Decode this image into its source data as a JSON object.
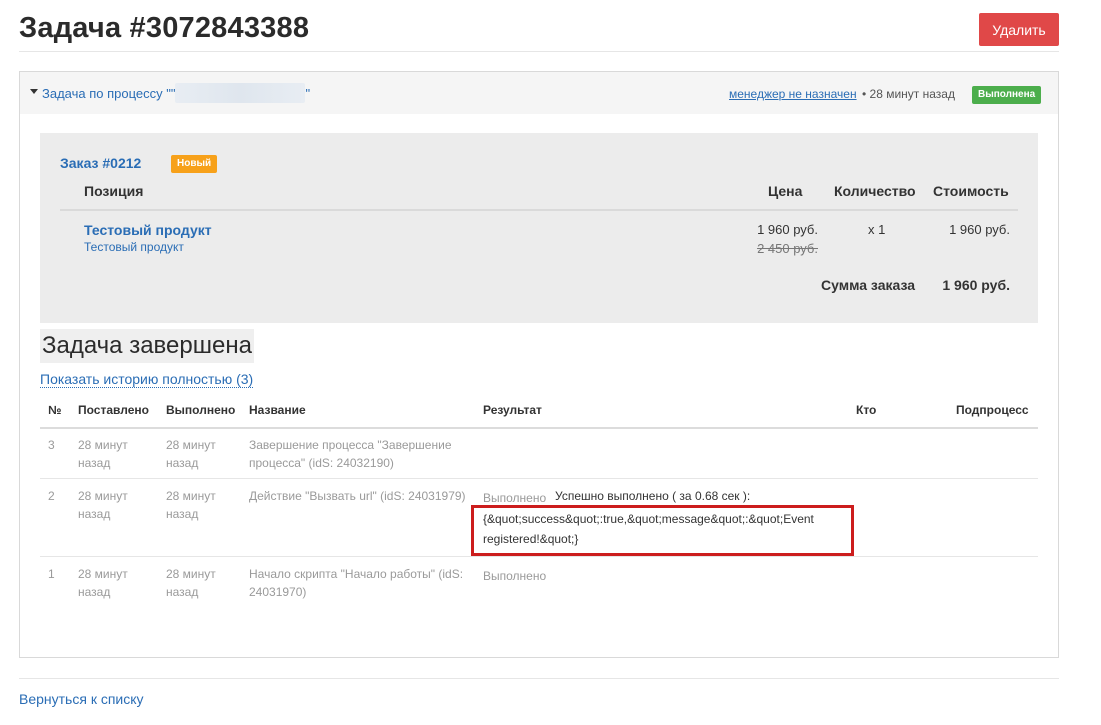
{
  "page": {
    "title": "Задача #3072843388",
    "delete_label": "Удалить"
  },
  "task_header": {
    "process_prefix": "Задача по процессу \"\"",
    "process_suffix": "\"",
    "manager_link": "менеджер не назначен",
    "time": "• 28 минут назад",
    "status": "Выполнена"
  },
  "order": {
    "link": "Заказ #0212",
    "badge": "Новый",
    "headers": {
      "position": "Позиция",
      "price": "Цена",
      "qty": "Количество",
      "cost": "Стоимость"
    },
    "item": {
      "name": "Тестовый продукт",
      "sub": "Тестовый продукт",
      "price": "1 960 руб.",
      "old_price": "2 450 руб.",
      "qty": "x 1",
      "cost": "1 960 руб."
    },
    "sum_label": "Сумма заказа",
    "sum_value": "1 960 руб."
  },
  "done_heading": "Задача завершена",
  "history_link": "Показать историю полностью (3)",
  "history": {
    "headers": [
      "№",
      "Поставлено",
      "Выполнено",
      "Название",
      "Результат",
      "Кто",
      "Подпроцесс"
    ],
    "rows": [
      {
        "n": "3",
        "placed": "28 минут назад",
        "done": "28 минут назад",
        "name": "Завершение процесса \"Завершение процесса\" (idS: 24032190)",
        "result_status": "",
        "result_detail": ""
      },
      {
        "n": "2",
        "placed": "28 минут назад",
        "done": "28 минут назад",
        "name": "Действие \"Вызвать url\" (idS: 24031979)",
        "result_status": "Выполнено",
        "result_detail": "Успешно выполнено ( за 0.68 сек ):",
        "result_body": "{&quot;success&quot;:true,&quot;message&quot;:&quot;Event registered!&quot;}"
      },
      {
        "n": "1",
        "placed": "28 минут назад",
        "done": "28 минут назад",
        "name": "Начало скрипта \"Начало работы\" (idS: 24031970)",
        "result_status": "Выполнено",
        "result_detail": ""
      }
    ]
  },
  "back_link": "Вернуться к списку",
  "colors": {
    "accent_link": "#2a6db5",
    "danger": "#e04848",
    "success": "#4cae4c",
    "warning": "#f7a11a",
    "highlight_border": "#cc1d1d"
  }
}
